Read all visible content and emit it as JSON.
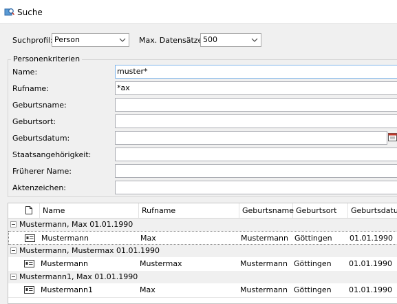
{
  "window": {
    "title": "Suche",
    "icon": "search-window-icon"
  },
  "toolbar": {
    "profile_label": "Suchprofil:",
    "profile_value": "Person",
    "max_label": "Max. Datensätze:",
    "max_value": "500"
  },
  "criteria": {
    "group_title": "Personenkriterien",
    "fields": [
      {
        "label": "Name:",
        "value": "muster*"
      },
      {
        "label": "Rufname:",
        "value": "*ax"
      },
      {
        "label": "Geburtsname:",
        "value": ""
      },
      {
        "label": "Geburtsort:",
        "value": ""
      },
      {
        "label": "Geburtsdatum:",
        "value": ""
      },
      {
        "label": "Staatsangehörigkeit:",
        "value": ""
      },
      {
        "label": "Früherer Name:",
        "value": ""
      },
      {
        "label": "Aktenzeichen:",
        "value": ""
      }
    ]
  },
  "results": {
    "columns": [
      "Name",
      "Rufname",
      "Geburtsname",
      "Geburtsort",
      "Geburtsdatum"
    ],
    "groups": [
      {
        "title": "Mustermann, Max 01.01.1990",
        "row": {
          "name": "Mustermann",
          "rufname": "Max",
          "geburtsname": "Mustermann",
          "geburtsort": "Göttingen",
          "geburtsdatum": "01.01.1990"
        }
      },
      {
        "title": "Mustermann, Mustermax 01.01.1990",
        "row": {
          "name": "Mustermann",
          "rufname": "Mustermax",
          "geburtsname": "Mustermann",
          "geburtsort": "Göttingen",
          "geburtsdatum": "01.01.1990"
        }
      },
      {
        "title": "Mustermann1, Max 01.01.1990",
        "row": {
          "name": "Mustermann1",
          "rufname": "Max",
          "geburtsname": "Mustermann",
          "geburtsort": "Göttingen",
          "geburtsdatum": "01.01.1990"
        }
      }
    ]
  }
}
